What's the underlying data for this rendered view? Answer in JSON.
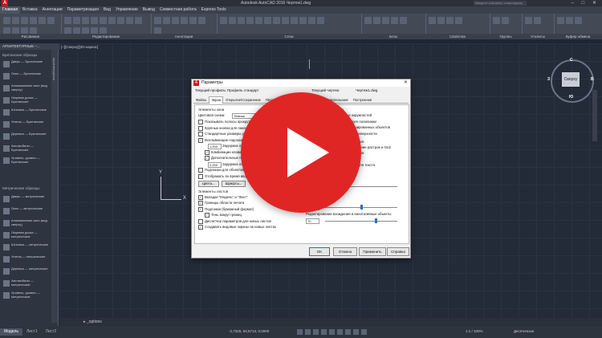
{
  "window": {
    "logo": "A",
    "title": "Autodesk AutoCAD 2016   Чертеж1.dwg",
    "search_placeholder": "Введите ключевое слово/фразу",
    "controls": "– □ ✕"
  },
  "ribbon": {
    "tabs": [
      "Главная",
      "Вставка",
      "Аннотации",
      "Параметризация",
      "Вид",
      "Управление",
      "Вывод",
      "Совместная работа",
      "Express Tools"
    ],
    "groups": [
      "Рисование",
      "Редактирование",
      "Аннотации",
      "Слои",
      "Блок",
      "Свойства",
      "Группы",
      "Утилиты",
      "Буфер обмена"
    ]
  },
  "palette": {
    "title": "АРХИТЕКТУРНЫЕ –...",
    "side_label": "Архитектурные",
    "section_metric": "Британские образцы",
    "items_imperial": [
      "Дверь — Британские",
      "Окно — Британские",
      "Алюминиевое окно (вид сверху)",
      "Лицевая доска — Британские",
      "Штаника — Британские",
      "Унитаз — Британские",
      "Деревья — Британские",
      "Автомобили — Британские",
      "Уровень, уровни — Британские"
    ],
    "section_metric2": "Метрические образцы",
    "items_metric": [
      "Дверь — метрические",
      "Окно — метрические",
      "Алюминиевое окно (вид сверху)",
      "Лицевая доска — метрические",
      "Штаника — метрические",
      "Унитаз — метрические",
      "Деревья — метрические",
      "Автомобили — метрические",
      "Уровень, уровни — метрические"
    ]
  },
  "viewport": {
    "label": "[–][Сверху][2D-каркас]",
    "ucs_x": "X",
    "ucs_y": "Y",
    "viewcube": {
      "face": "Сверху",
      "n": "С",
      "s": "Ю",
      "w": "З",
      "e": "В"
    }
  },
  "command": {
    "prompt": "▸ _options"
  },
  "status": {
    "layout_tabs": [
      "Модель",
      "Лист1",
      "Лист2"
    ],
    "coords": "-2,7326, 94,5713, 0,0000",
    "zoom": "1:1 / 100%",
    "workspace": "Десятичные"
  },
  "dialog": {
    "icon": "A",
    "title": "Параметры",
    "close": "✕",
    "current_profile_label": "Текущий профиль:",
    "current_profile_value": "Профиль стандарт",
    "current_drawing_label": "Текущий чертеж:",
    "current_drawing_value": "Чертеж1.dwg",
    "tabs": [
      "Файлы",
      "Экран",
      "Открытие/Сохранение",
      "Печать/Публикация",
      "Система",
      "Пользовательские",
      "Построения",
      "3D-моделирование"
    ],
    "left": {
      "window_title": "Элементы окна",
      "color_scheme_label": "Цветовая схема:",
      "color_scheme_value": "Темная",
      "checks": [
        {
          "label": "Показывать полосы прокрутки в окне чертежа",
          "checked": false
        },
        {
          "label": "Крупные кнопки для панелей инструментов",
          "checked": false
        },
        {
          "label": "Стандартные размеры для значков ленты",
          "checked": false
        },
        {
          "label": "Всплывающие подсказки",
          "checked": true
        }
      ],
      "delay1": "1.000",
      "delay1_label": "Задержка отображения",
      "sub_checks": [
        {
          "label": "Комбинации клавиш в подсказках",
          "checked": true
        },
        {
          "label": "Дополнительные подсказки",
          "checked": true
        }
      ],
      "delay2": "2.000",
      "delay2_label": "Задержка отображения",
      "more_checks": [
        {
          "label": "Подсказки для объектов",
          "checked": false
        },
        {
          "label": "Отображать во время ввода",
          "checked": false
        }
      ],
      "btn_colors": "Цвета...",
      "btn_fonts": "Шрифты...",
      "layout_title": "Элементы листов",
      "layout_checks": [
        {
          "label": "Вкладки \"Модель\" и \"Лист\"",
          "checked": true
        },
        {
          "label": "Границы области печати",
          "checked": true
        },
        {
          "label": "Подложка (бумажный формат)",
          "checked": true
        },
        {
          "label": "Тень вокруг границ",
          "checked": true
        },
        {
          "label": "Диспетчер параметров для новых листов",
          "checked": false
        },
        {
          "label": "Создавать видовые экраны на новых листах",
          "checked": true
        }
      ]
    },
    "right": {
      "resolution_title": "Экранное разрешение",
      "res_rows": [
        {
          "value": "1000",
          "label": "Сглаживание дуг и окружностей"
        },
        {
          "value": "8",
          "label": "Число сегментов в дуге полилинии"
        },
        {
          "value": "0.5",
          "label": "Сглаживание визуализированных объектов"
        },
        {
          "value": "4",
          "label": "Число образующих на поверхности"
        }
      ],
      "perf_title": "Производительность отображения",
      "perf_checks": [
        {
          "label": "Панорамирование и зумирование растров и OLE",
          "checked": false
        },
        {
          "label": "Выделять только рамку растров",
          "checked": true
        },
        {
          "label": "Применять заливку",
          "checked": true
        },
        {
          "label": "Показывать только контуры для текста",
          "checked": false
        },
        {
          "label": "Рисовать истинные силуэты",
          "checked": false
        }
      ],
      "crosshair_label": "Размер перекрестья",
      "crosshair_value": "5",
      "fade_title": "Контроль плотности",
      "fade_xref_label": "Внешние ссылки",
      "fade_xref_value": "50",
      "fade_inplace_label": "Редактирование вхождения и аннотативные объекты",
      "fade_inplace_value": "70"
    },
    "buttons": {
      "ok": "OK",
      "cancel": "Отмена",
      "apply": "Применить",
      "help": "Справка"
    }
  },
  "colors": {
    "play_red": "#e02624",
    "autocad_red": "#c8161d",
    "drawing_bg": "#232a38"
  },
  "icons": {
    "play": "play-icon",
    "app": "autocad-logo-icon"
  }
}
